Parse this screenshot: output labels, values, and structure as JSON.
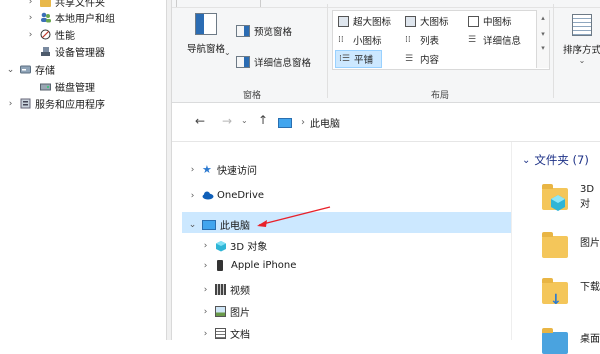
{
  "mmc_tree": {
    "items": [
      {
        "label": "共享文件夹"
      },
      {
        "label": "本地用户和组"
      },
      {
        "label": "性能"
      },
      {
        "label": "设备管理器"
      },
      {
        "label": "存储"
      },
      {
        "label": "磁盘管理"
      },
      {
        "label": "服务和应用程序"
      }
    ]
  },
  "ribbon": {
    "pane_group": {
      "nav_pane": "导航窗格",
      "preview_pane": "预览窗格",
      "details_pane": "详细信息窗格",
      "group_label": "窗格"
    },
    "layout_group": {
      "extra_large_icons": "超大图标",
      "large_icons": "大图标",
      "medium_icons": "中图标",
      "small_icons": "小图标",
      "list": "列表",
      "details": "详细信息",
      "tiles": "平铺",
      "content": "内容",
      "group_label": "布局"
    },
    "sort": {
      "label": "排序方式"
    }
  },
  "address": {
    "location": "此电脑",
    "separator": "›"
  },
  "nav_tree": {
    "quick_access": "快速访问",
    "onedrive": "OneDrive",
    "this_pc": "此电脑",
    "children": [
      {
        "label": "3D 对象"
      },
      {
        "label": "Apple iPhone"
      },
      {
        "label": "视频"
      },
      {
        "label": "图片"
      },
      {
        "label": "文档"
      }
    ]
  },
  "content_pane": {
    "section_header": "文件夹 (7)",
    "items": [
      {
        "label": "3D 对"
      },
      {
        "label": "图片"
      },
      {
        "label": "下载"
      },
      {
        "label": "桌面"
      }
    ]
  },
  "colors": {
    "selection": "#cce8ff",
    "accent": "#0078d7",
    "arrow": "#e8212a"
  }
}
